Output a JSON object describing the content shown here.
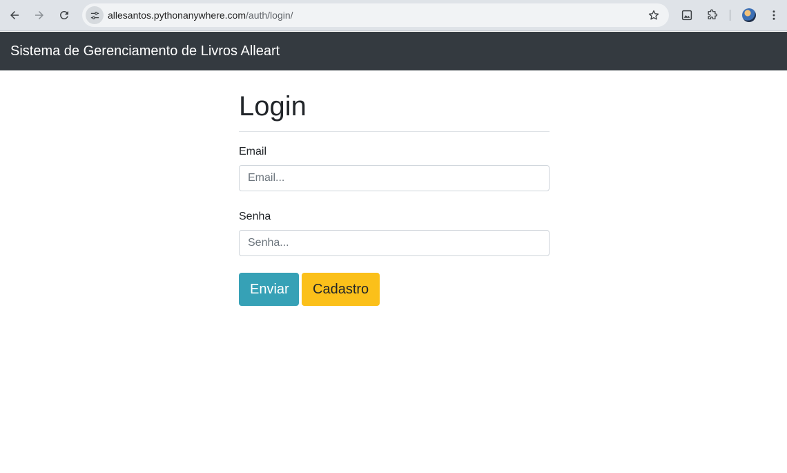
{
  "browser": {
    "url_host": "allesantos.pythonanywhere.com",
    "url_path": "/auth/login/",
    "icons": [
      "back-arrow-icon",
      "forward-arrow-icon",
      "reload-icon",
      "site-info-icon",
      "star-icon",
      "image-icon",
      "extensions-icon",
      "profile-avatar",
      "more-menu-icon"
    ]
  },
  "navbar": {
    "brand": "Sistema de Gerenciamento de Livros Alleart",
    "background": "#343a40"
  },
  "form": {
    "title": "Login",
    "email_label": "Email",
    "email_placeholder": "Email...",
    "email_value": "",
    "senha_label": "Senha",
    "senha_placeholder": "Senha...",
    "senha_value": "",
    "submit_label": "Enviar",
    "register_label": "Cadastro"
  },
  "colors": {
    "submit_button": "#36a1b6",
    "register_button": "#fbc01a"
  }
}
